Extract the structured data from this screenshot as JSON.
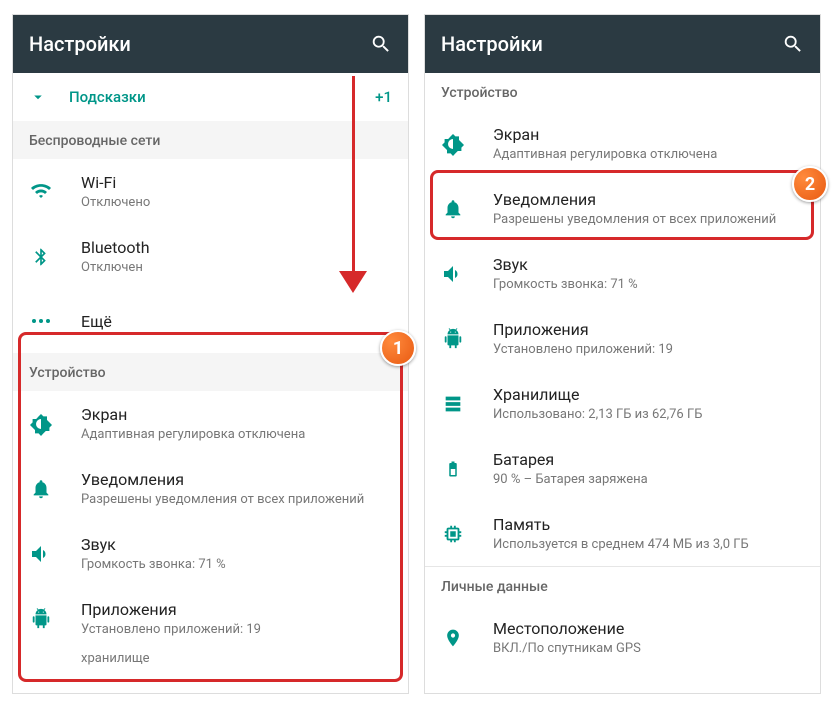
{
  "left": {
    "appbar_title": "Настройки",
    "hints_label": "Подсказки",
    "hints_badge": "+1",
    "section_wireless": "Беспроводные сети",
    "wifi": {
      "title": "Wi-Fi",
      "sub": "Отключено"
    },
    "bluetooth": {
      "title": "Bluetooth",
      "sub": "Отключен"
    },
    "more": {
      "title": "Ещё"
    },
    "section_device": "Устройство",
    "display": {
      "title": "Экран",
      "sub": "Адаптивная регулировка отключена"
    },
    "notifications": {
      "title": "Уведомления",
      "sub": "Разрешены уведомления от всех приложений"
    },
    "sound": {
      "title": "Звук",
      "sub": "Громкость звонка: 71 %"
    },
    "apps": {
      "title": "Приложения",
      "sub": "Установлено приложений: 19"
    },
    "cut": "хранилище"
  },
  "right": {
    "appbar_title": "Настройки",
    "section_device": "Устройство",
    "display": {
      "title": "Экран",
      "sub": "Адаптивная регулировка отключена"
    },
    "notifications": {
      "title": "Уведомления",
      "sub": "Разрешены уведомления от всех приложений"
    },
    "sound": {
      "title": "Звук",
      "sub": "Громкость звонка: 71 %"
    },
    "apps": {
      "title": "Приложения",
      "sub": "Установлено приложений: 19"
    },
    "storage": {
      "title": "Хранилище",
      "sub": "Использовано: 2,13 ГБ из 62,76 ГБ"
    },
    "battery": {
      "title": "Батарея",
      "sub": "90 % – Батарея заряжена"
    },
    "memory": {
      "title": "Память",
      "sub": "Используется в среднем 474 МБ из 3,0 ГБ"
    },
    "section_personal": "Личные данные",
    "location": {
      "title": "Местоположение",
      "sub": "ВКЛ./По спутникам GPS"
    }
  },
  "badges": {
    "one": "1",
    "two": "2"
  }
}
